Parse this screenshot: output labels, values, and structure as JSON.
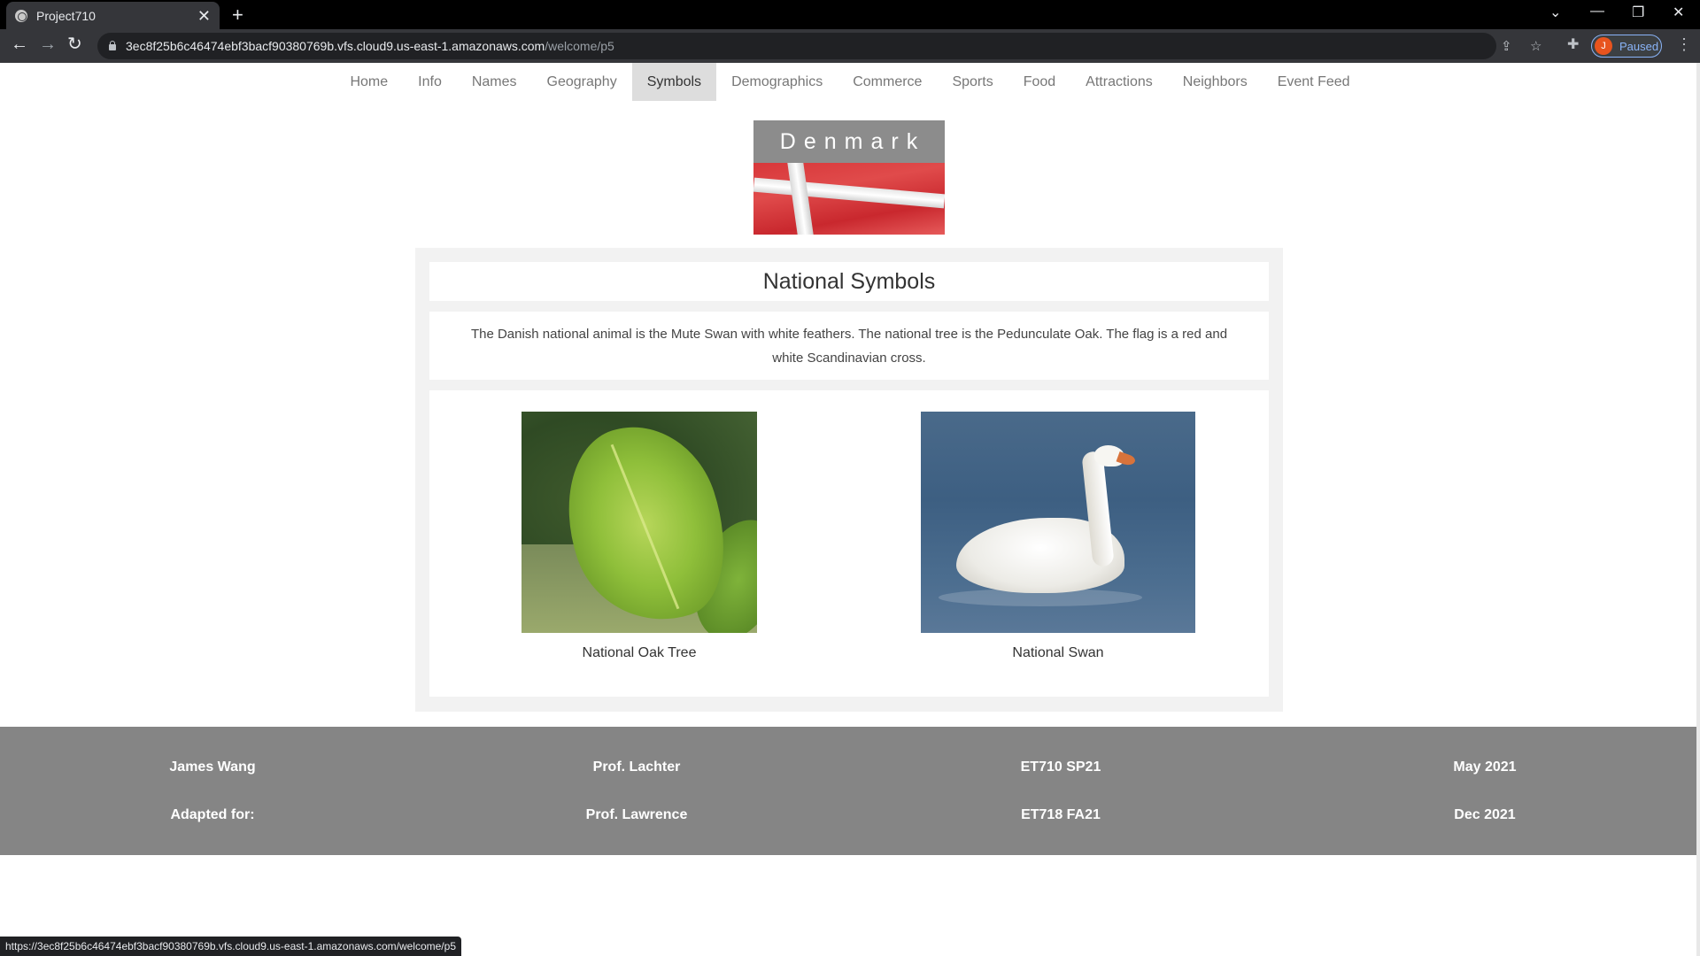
{
  "browser": {
    "tab_title": "Project710",
    "tab_close": "✕",
    "new_tab": "+",
    "url_host": "3ec8f25b6c46474ebf3bacf90380769b.vfs.cloud9.us-east-1.amazonaws.com",
    "url_path": "/welcome/p5",
    "profile_initial": "J",
    "profile_status": "Paused",
    "status_url": "https://3ec8f25b6c46474ebf3bacf90380769b.vfs.cloud9.us-east-1.amazonaws.com/welcome/p5"
  },
  "nav": {
    "items": [
      "Home",
      "Info",
      "Names",
      "Geography",
      "Symbols",
      "Demographics",
      "Commerce",
      "Sports",
      "Food",
      "Attractions",
      "Neighbors",
      "Event Feed"
    ],
    "active": "Symbols"
  },
  "banner": {
    "country": "Denmark"
  },
  "main": {
    "heading": "National Symbols",
    "description": "The Danish national animal is the Mute Swan with white feathers. The national tree is the Pedunculate Oak. The flag is a red and white Scandinavian cross.",
    "figures": [
      {
        "caption": "National Oak Tree"
      },
      {
        "caption": "National Swan"
      }
    ]
  },
  "footer": {
    "row1": [
      "James Wang",
      "Prof. Lachter",
      "ET710 SP21",
      "May 2021"
    ],
    "row2": [
      "Adapted for:",
      "Prof. Lawrence",
      "ET718 FA21",
      "Dec 2021"
    ]
  }
}
